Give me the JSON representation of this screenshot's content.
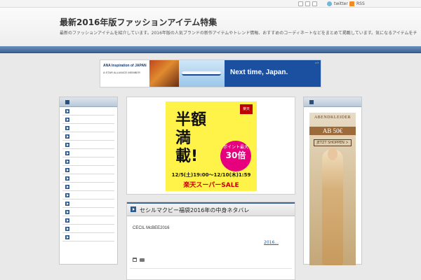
{
  "topbar": {
    "twitter_label": "twitter",
    "rss_label": "RSS"
  },
  "header": {
    "site_title": "最新2016年版ファッションアイテム特集",
    "site_desc": "最新のファッションアイテムを紹介しています。2016年版の人気ブランドの新作アイテムやトレンド情報、おすすめのコーディネートなどをまとめて掲載しています。気になるアイテムをチェックして、お気に入りを見つけてください。LINEでも最新情報を配信しています。"
  },
  "top_banner": {
    "brand": "ANA Inspiration of JAPAN",
    "alliance": "A STAR ALLIANCE MEMBER",
    "tagline": "Next time, Japan."
  },
  "left_sidebar": {
    "item_count": 16
  },
  "right_sidebar": {
    "ad": {
      "brand": "ABENDKLEIDER",
      "price": "AB 50€",
      "cta": "JETZT SHOPPEN >"
    }
  },
  "sale_ad": {
    "shop": "楽天",
    "headline": "半額満載!",
    "burst_top": "ポイント最大",
    "burst_big": "30倍",
    "dates": "12/5(土)19:00～12/10(木)1:59",
    "name": "楽天スーパーSALE"
  },
  "post": {
    "title": "セシルマクビー福袋2016年の中身ネタバレ",
    "excerpt": "CECIL McBEE2016",
    "more_link": "2016..."
  },
  "colors": {
    "accent": "#3d6597",
    "link": "#2a5ea8"
  }
}
